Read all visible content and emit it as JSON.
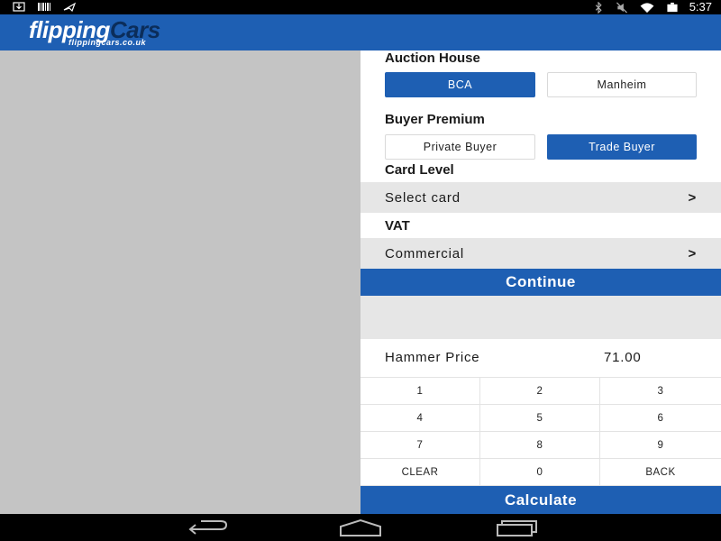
{
  "status_bar": {
    "time": "5:37",
    "icons": [
      "download-icon",
      "barcode-icon",
      "airplane-alert-icon",
      "bluetooth-icon",
      "mute-icon",
      "wifi-icon",
      "battery-icon"
    ]
  },
  "header": {
    "logo_main_part1": "flipping",
    "logo_main_part2": "Cars",
    "logo_sub": "flippingcars.co.uk"
  },
  "auction_house": {
    "title": "Auction House",
    "options": [
      "BCA",
      "Manheim"
    ],
    "selected": "BCA"
  },
  "buyer_premium": {
    "title": "Buyer Premium",
    "options": [
      "Private Buyer",
      "Trade Buyer"
    ],
    "selected": "Trade Buyer"
  },
  "card_level": {
    "title": "Card Level",
    "value": "Select card",
    "chevron": ">"
  },
  "vat": {
    "title": "VAT",
    "value": "Commercial",
    "chevron": ">"
  },
  "continue_label": "Continue",
  "hammer": {
    "label": "Hammer Price",
    "value": "71.00"
  },
  "keypad": {
    "keys": [
      "1",
      "2",
      "3",
      "4",
      "5",
      "6",
      "7",
      "8",
      "9",
      "CLEAR",
      "0",
      "BACK"
    ]
  },
  "calculate_label": "Calculate",
  "colors": {
    "brand_blue": "#1e5fb3",
    "row_gray": "#e6e6e6",
    "left_pane_gray": "#c4c4c4"
  },
  "nav": {
    "icons": [
      "back-icon",
      "home-icon",
      "recents-icon"
    ]
  }
}
